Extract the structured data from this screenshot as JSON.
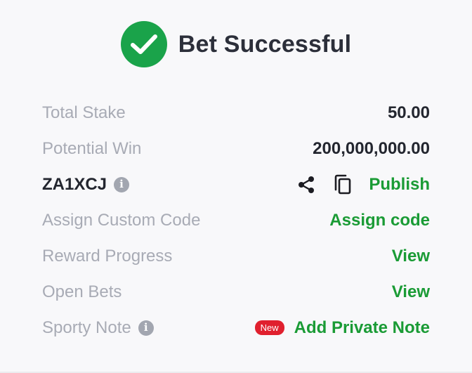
{
  "header": {
    "title": "Bet Successful",
    "icon": "check-circle-icon",
    "icon_color": "#1aa34a"
  },
  "rows": {
    "total_stake": {
      "label": "Total Stake",
      "value": "50.00"
    },
    "potential_win": {
      "label": "Potential Win",
      "value": "200,000,000.00"
    },
    "booking": {
      "code": "ZA1XCJ",
      "info_icon": "info-icon",
      "share_icon": "share-icon",
      "copy_icon": "copy-icon",
      "publish_label": "Publish"
    },
    "custom_code": {
      "label": "Assign Custom Code",
      "action": "Assign code"
    },
    "reward_progress": {
      "label": "Reward Progress",
      "action": "View"
    },
    "open_bets": {
      "label": "Open Bets",
      "action": "View"
    },
    "sporty_note": {
      "label": "Sporty Note",
      "info_icon": "info-icon",
      "badge": "New",
      "action": "Add Private Note"
    }
  },
  "colors": {
    "accent_green": "#1a9b35",
    "badge_red": "#e0202e",
    "muted_text": "#a8abb5",
    "dark_text": "#23262f"
  }
}
